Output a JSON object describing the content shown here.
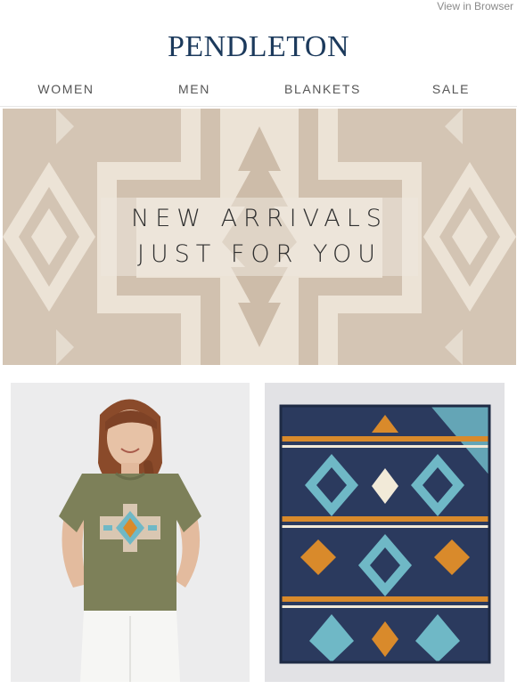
{
  "header": {
    "view_in_browser": "View in Browser",
    "logo_text": "PENDLETON"
  },
  "nav": {
    "items": [
      {
        "label": "WOMEN"
      },
      {
        "label": "MEN"
      },
      {
        "label": "BLANKETS"
      },
      {
        "label": "SALE"
      }
    ]
  },
  "hero": {
    "line1": "NEW ARRIVALS",
    "line2": "JUST FOR YOU"
  },
  "products": [
    {
      "image": "woman-in-olive-graphic-tee"
    },
    {
      "image": "navy-southwestern-pattern-blanket"
    }
  ],
  "colors": {
    "logo": "#1c3a5c",
    "hero_bg": "#d3c3b2",
    "hero_pattern": "#eee6da",
    "tee": "#7d8059",
    "blanket": "#2b3a5e",
    "accent_teal": "#6fb8c6",
    "accent_orange": "#d98a2b"
  }
}
